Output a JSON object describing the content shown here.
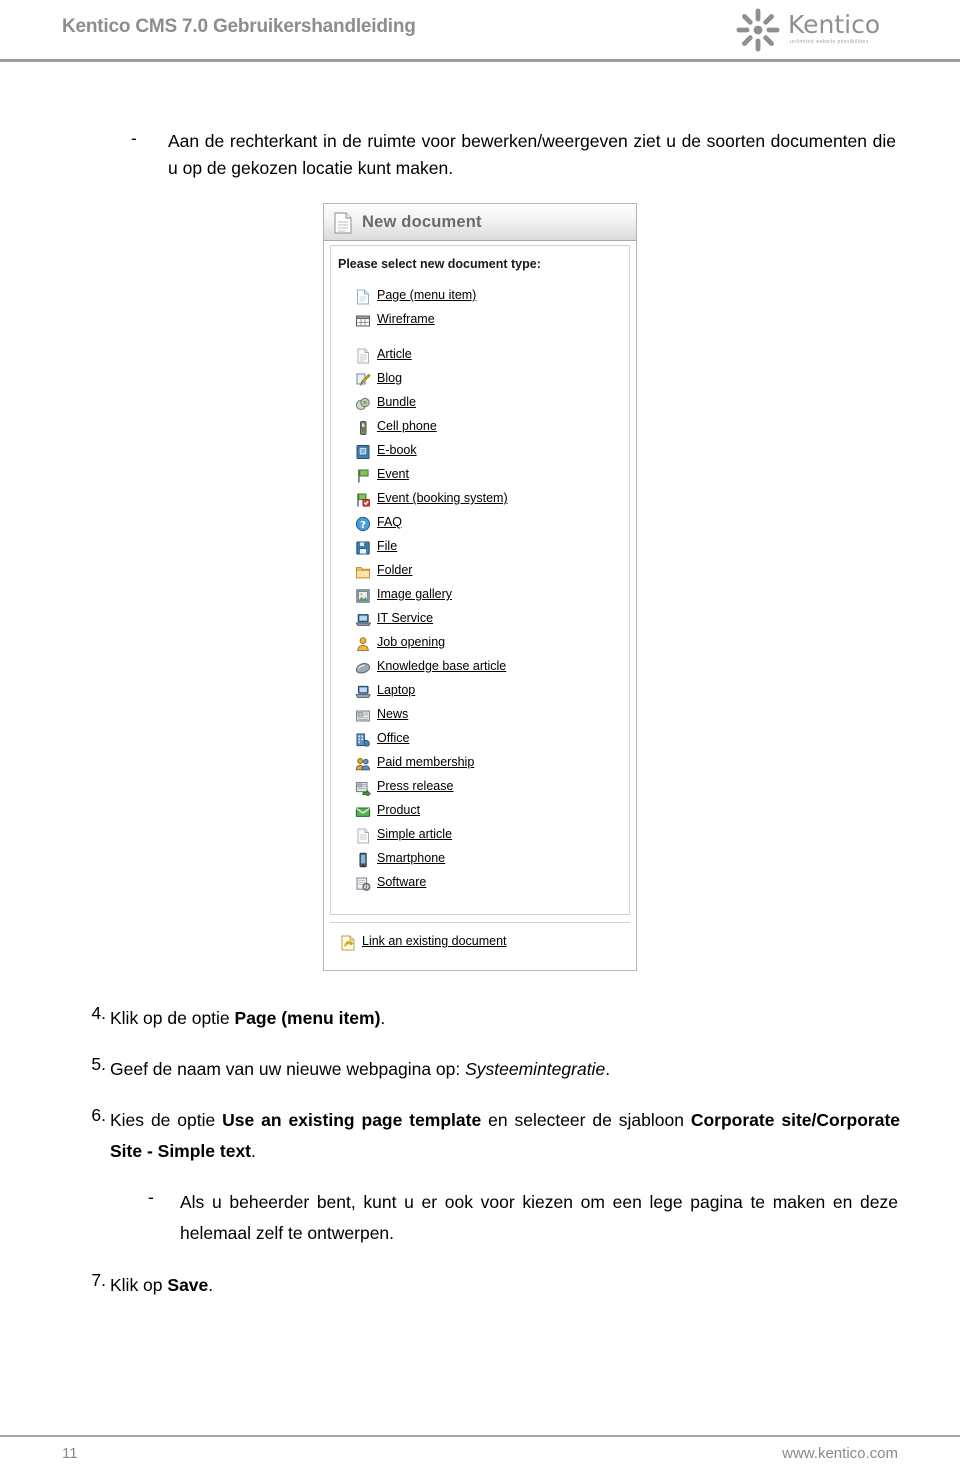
{
  "header": {
    "title": "Kentico CMS 7.0 Gebruikershandleiding",
    "logo_word": "Kentico",
    "logo_tagline": "unlimited website possibilities",
    "logo_icon": "kentico-flower-logo"
  },
  "intro": {
    "marker": "-",
    "text": "Aan de rechterkant in de ruimte voor bewerken/weergeven ziet u de soorten documenten die u op de gekozen locatie kunt maken."
  },
  "screenshot": {
    "titlebar": {
      "icon": "document-icon",
      "title": "New document"
    },
    "prompt": "Please select new document type:",
    "document_types": [
      {
        "icon": "page-icon",
        "label": "Page (menu item)",
        "gap_after": false
      },
      {
        "icon": "wireframe-grid-icon",
        "label": "Wireframe",
        "gap_after": true
      },
      {
        "icon": "article-icon",
        "label": "Article",
        "gap_after": false
      },
      {
        "icon": "blog-pencil-icon",
        "label": "Blog",
        "gap_after": false
      },
      {
        "icon": "bundle-icon",
        "label": "Bundle",
        "gap_after": false
      },
      {
        "icon": "cell-phone-icon",
        "label": "Cell phone",
        "gap_after": false
      },
      {
        "icon": "e-book-icon",
        "label": "E-book",
        "gap_after": false
      },
      {
        "icon": "event-flag-icon",
        "label": "Event",
        "gap_after": false
      },
      {
        "icon": "event-booking-icon",
        "label": "Event (booking system)",
        "gap_after": false
      },
      {
        "icon": "faq-question-icon",
        "label": "FAQ",
        "gap_after": false
      },
      {
        "icon": "file-save-icon",
        "label": "File",
        "gap_after": false
      },
      {
        "icon": "folder-icon",
        "label": "Folder",
        "gap_after": false
      },
      {
        "icon": "image-gallery-icon",
        "label": "Image gallery",
        "gap_after": false
      },
      {
        "icon": "it-service-icon",
        "label": "IT Service",
        "gap_after": false
      },
      {
        "icon": "job-opening-icon",
        "label": "Job opening",
        "gap_after": false
      },
      {
        "icon": "knowledge-base-icon",
        "label": "Knowledge base article",
        "gap_after": false
      },
      {
        "icon": "laptop-icon",
        "label": "Laptop",
        "gap_after": false
      },
      {
        "icon": "news-icon",
        "label": "News",
        "gap_after": false
      },
      {
        "icon": "office-icon",
        "label": "Office",
        "gap_after": false
      },
      {
        "icon": "paid-membership-icon",
        "label": "Paid membership",
        "gap_after": false
      },
      {
        "icon": "press-release-icon",
        "label": "Press release",
        "gap_after": false
      },
      {
        "icon": "product-icon",
        "label": "Product",
        "gap_after": false
      },
      {
        "icon": "simple-article-icon",
        "label": "Simple article",
        "gap_after": false
      },
      {
        "icon": "smartphone-icon",
        "label": "Smartphone",
        "gap_after": false
      },
      {
        "icon": "software-icon",
        "label": "Software",
        "gap_after": false
      }
    ],
    "link_existing": {
      "icon": "link-document-icon",
      "label": "Link an existing document"
    }
  },
  "steps": {
    "step4_num": "4.",
    "step4_pre": "Klik op de optie ",
    "step4_bold": "Page (menu item)",
    "step4_post": ".",
    "step5_num": "5.",
    "step5_pre": "Geef de naam van uw nieuwe webpagina op: ",
    "step5_italic": "Systeemintegratie",
    "step5_post": ".",
    "step6_num": "6.",
    "step6_a": "Kies de optie ",
    "step6_b1": "Use an existing page template",
    "step6_c": " en selecteer de sjabloon ",
    "step6_b2": "Corporate site/Corporate Site - Simple text",
    "step6_d": ".",
    "sub_marker": "-",
    "sub_text": "Als u beheerder bent, kunt u er ook voor kiezen om een lege pagina te maken en deze helemaal zelf te ontwerpen.",
    "step7_num": "7.",
    "step7_pre": "Klik op ",
    "step7_bold": "Save",
    "step7_post": "."
  },
  "footer": {
    "page_number": "11",
    "url": "www.kentico.com"
  },
  "colors": {
    "header_gray": "#8d8d8d",
    "rule_gray": "#9e9e9e",
    "titlebar_text": "#666c72",
    "footer_gray": "#8a8a8a"
  }
}
